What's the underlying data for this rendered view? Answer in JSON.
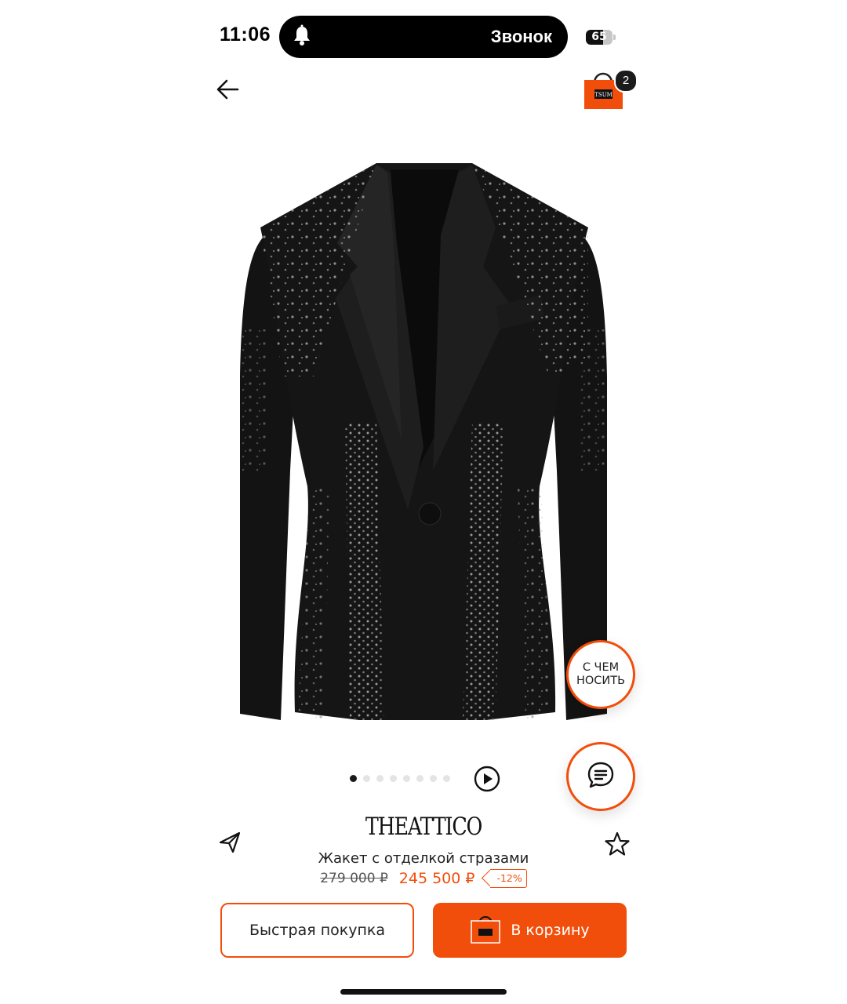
{
  "status_bar": {
    "time": "11:06",
    "island_label": "Звонок",
    "battery_level": "65",
    "battery_fraction": 0.65
  },
  "nav": {
    "back_icon": "arrow-left-icon",
    "cart_icon": "shopping-bag-icon",
    "cart_count": "2",
    "cart_logo": "TSUM"
  },
  "product": {
    "image_alt": "product-photo",
    "brand": "THEATTICO",
    "name": "Жакет с отделкой стразами",
    "old_price": "279 000 ₽",
    "price": "245 500 ₽",
    "discount": "-12%"
  },
  "floating": {
    "outfit_label": "С ЧЕМ НОСИТЬ",
    "chat_icon": "chat-bubble-icon"
  },
  "carousel": {
    "total": 8,
    "active_index": 0,
    "video_icon": "play-icon"
  },
  "actions": {
    "quick_buy": "Быстрая покупка",
    "add_to_cart": "В корзину"
  },
  "colors": {
    "accent": "#f24e0b",
    "text": "#111111",
    "background": "#ffffff"
  }
}
